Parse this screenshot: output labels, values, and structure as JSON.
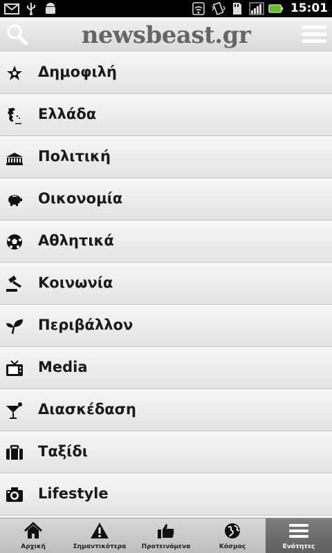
{
  "status": {
    "time": "15:01"
  },
  "app": {
    "title": "newsbeast.gr"
  },
  "categories": [
    {
      "label": "Δημοφιλή",
      "icon": "star-icon"
    },
    {
      "label": "Ελλάδα",
      "icon": "greece-map-icon"
    },
    {
      "label": "Πολιτική",
      "icon": "parliament-icon"
    },
    {
      "label": "Οικονομία",
      "icon": "piggy-bank-icon"
    },
    {
      "label": "Αθλητικά",
      "icon": "soccer-ball-icon"
    },
    {
      "label": "Κοινωνία",
      "icon": "gavel-icon"
    },
    {
      "label": "Περιβάλλον",
      "icon": "leaf-icon"
    },
    {
      "label": "Media",
      "icon": "tv-icon"
    },
    {
      "label": "Διασκέδαση",
      "icon": "cocktail-icon"
    },
    {
      "label": "Ταξίδι",
      "icon": "suitcase-icon"
    },
    {
      "label": "Lifestyle",
      "icon": "camera-icon"
    }
  ],
  "tabs": [
    {
      "label": "Αρχική",
      "icon": "home-icon"
    },
    {
      "label": "Σημαντικότερα",
      "icon": "warning-icon"
    },
    {
      "label": "Προτεινόμενα",
      "icon": "thumbs-up-icon"
    },
    {
      "label": "Κόσμος",
      "icon": "globe-icon"
    },
    {
      "label": "Ενότητες",
      "icon": "menu-icon",
      "active": true
    }
  ]
}
